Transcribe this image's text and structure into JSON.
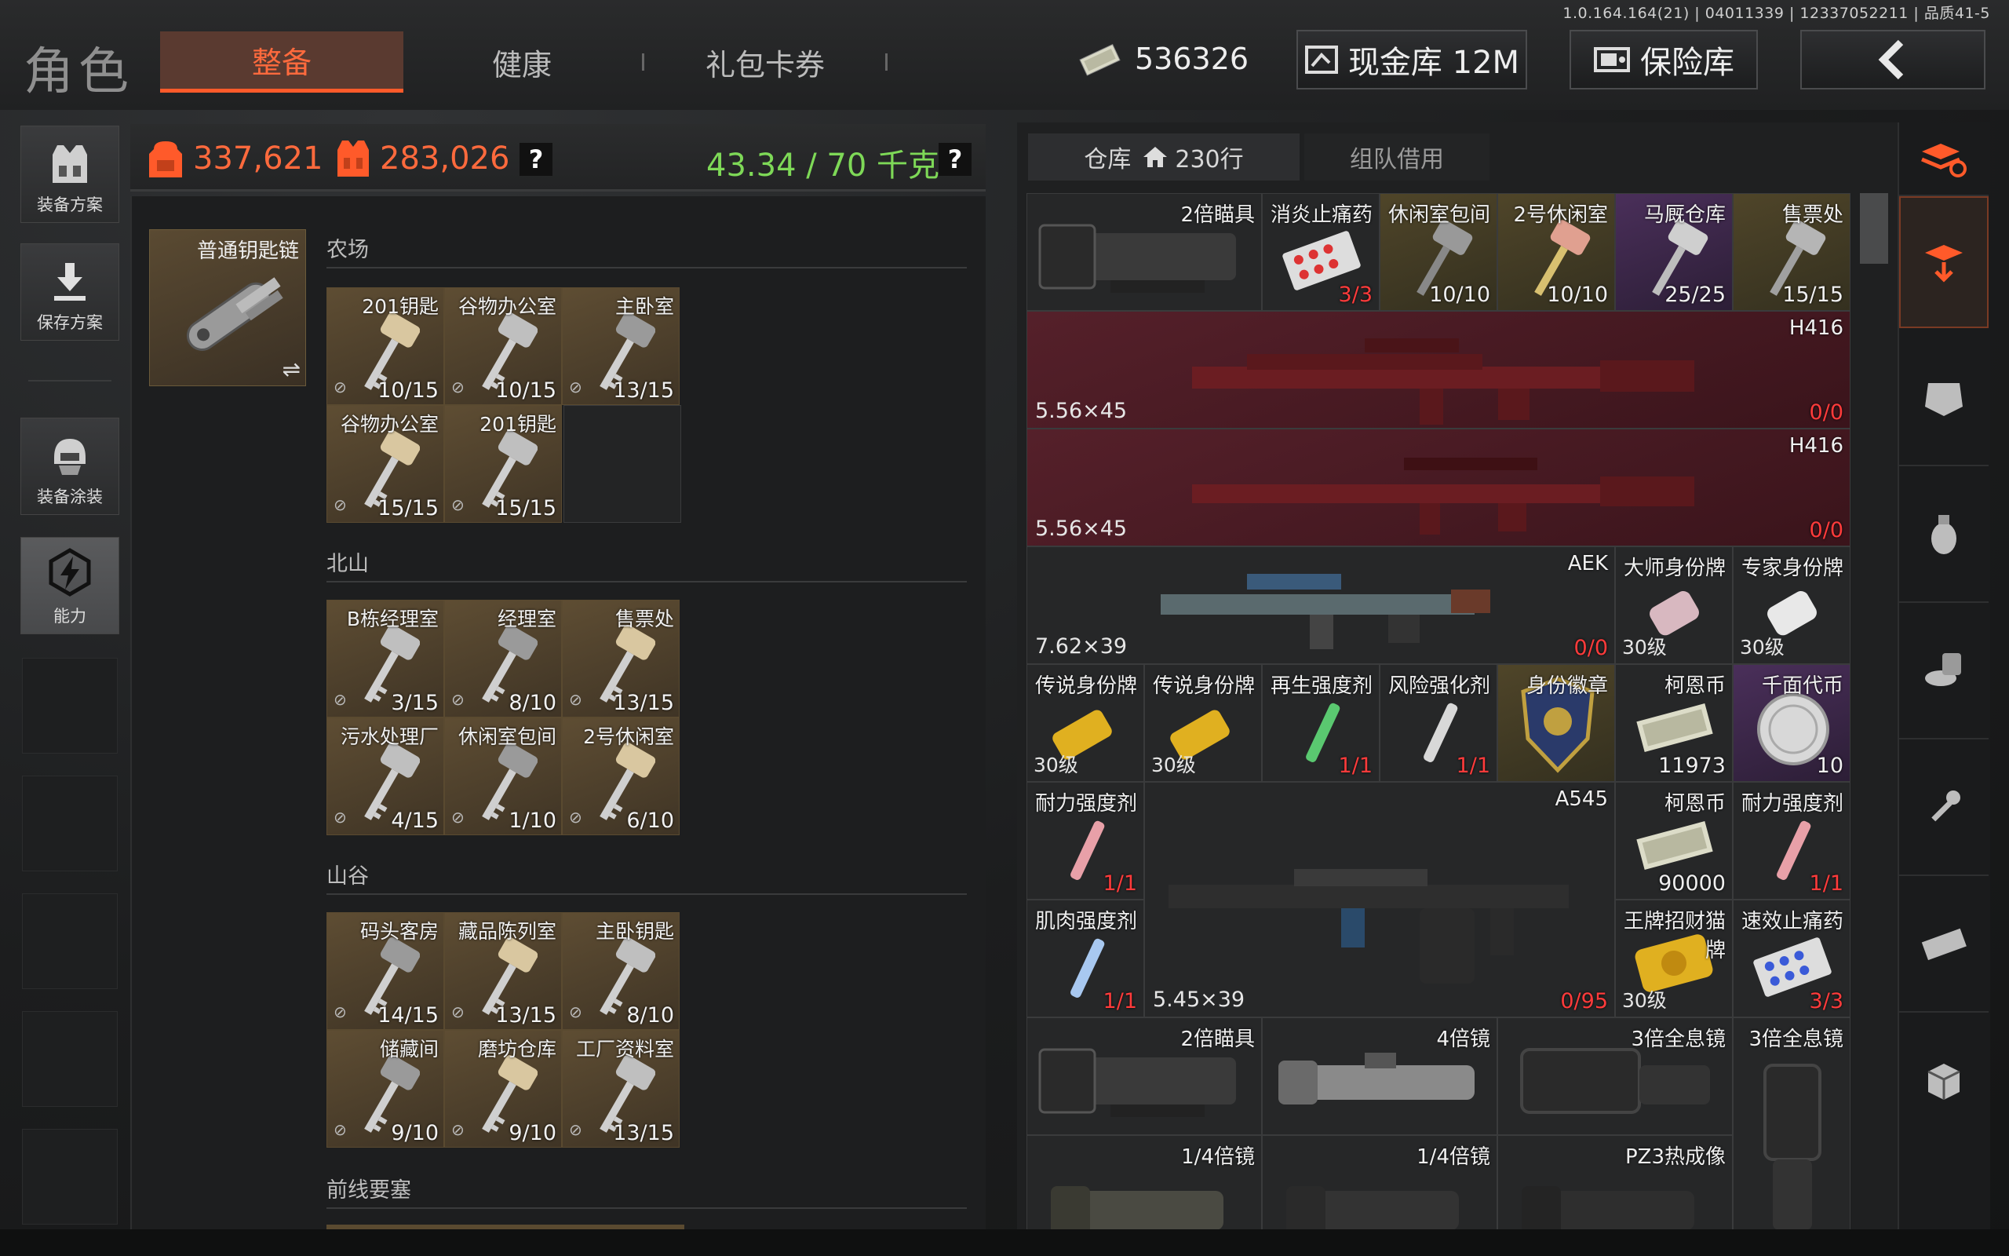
{
  "version": "1.0.164.164(21) | 04011339 | 12337052211 | 品质41-5",
  "title": "角色",
  "tabs": [
    {
      "label": "整备"
    },
    {
      "label": "健康"
    },
    {
      "label": "礼包卡券"
    }
  ],
  "currency": {
    "amount": "536326"
  },
  "cash_vault": {
    "label": "现金库 12M"
  },
  "safe": {
    "label": "保险库"
  },
  "left_buttons": [
    {
      "label": "装备方案"
    },
    {
      "label": "保存方案"
    },
    {
      "label": "装备涂装"
    },
    {
      "label": "能力"
    }
  ],
  "stats": {
    "value1": "337,621",
    "value2": "283,026",
    "weight": "43.34 / 70 千克",
    "help": "?"
  },
  "keychain": {
    "label": "普通钥匙链",
    "swap": "⇌"
  },
  "sections": [
    {
      "name": "农场",
      "keys": [
        {
          "name": "201钥匙",
          "count": "10/15"
        },
        {
          "name": "谷物办公室",
          "count": "10/15"
        },
        {
          "name": "主卧室",
          "count": "13/15"
        },
        {
          "name": "谷物办公室",
          "count": "15/15"
        },
        {
          "name": "201钥匙",
          "count": "15/15"
        }
      ]
    },
    {
      "name": "北山",
      "keys": [
        {
          "name": "B栋经理室",
          "count": "3/15"
        },
        {
          "name": "经理室",
          "count": "8/10"
        },
        {
          "name": "售票处",
          "count": "13/15"
        },
        {
          "name": "污水处理厂",
          "count": "4/15"
        },
        {
          "name": "休闲室包间",
          "count": "1/10"
        },
        {
          "name": "2号休闲室",
          "count": "6/10"
        }
      ]
    },
    {
      "name": "山谷",
      "keys": [
        {
          "name": "码头客房",
          "count": "14/15"
        },
        {
          "name": "藏品陈列室",
          "count": "13/15"
        },
        {
          "name": "主卧钥匙",
          "count": "8/10"
        },
        {
          "name": "储藏间",
          "count": "9/10"
        },
        {
          "name": "磨坊仓库",
          "count": "9/10"
        },
        {
          "name": "工厂资料室",
          "count": "13/15"
        }
      ]
    },
    {
      "name": "前线要塞",
      "keys": []
    }
  ],
  "warehouse": {
    "tab_label": "仓库",
    "rows": "230行",
    "team_tab": "组队借用"
  },
  "items": {
    "scope2x_a": {
      "name": "2倍瞄具"
    },
    "painkiller": {
      "name": "消炎止痛药",
      "count": "3/3"
    },
    "k_lounge": {
      "name": "休闲室包间",
      "count": "10/10"
    },
    "k_lounge2": {
      "name": "2号休闲室",
      "count": "10/10"
    },
    "k_stable": {
      "name": "马厩仓库",
      "count": "25/25"
    },
    "k_ticket": {
      "name": "售票处",
      "count": "15/15"
    },
    "h416a": {
      "name": "H416",
      "caliber": "5.56×45",
      "ammo": "0/0"
    },
    "h416b": {
      "name": "H416",
      "caliber": "5.56×45",
      "ammo": "0/0"
    },
    "aek": {
      "name": "AEK",
      "caliber": "7.62×39",
      "ammo": "0/0"
    },
    "tag_master": {
      "name": "大师身份牌",
      "level": "30级"
    },
    "tag_expert": {
      "name": "专家身份牌",
      "level": "30级"
    },
    "tag_legend1": {
      "name": "传说身份牌",
      "level": "30级"
    },
    "tag_legend2": {
      "name": "传说身份牌",
      "level": "30级"
    },
    "regen": {
      "name": "再生强度剂",
      "count": "1/1"
    },
    "risk": {
      "name": "风险强化剂",
      "count": "1/1"
    },
    "badge": {
      "name": "身份徽章"
    },
    "coin1": {
      "name": "柯恩币",
      "count": "11973"
    },
    "faceless": {
      "name": "千面代币",
      "count": "10"
    },
    "stamina1": {
      "name": "耐力强度剂",
      "count": "1/1"
    },
    "a545": {
      "name": "A545",
      "caliber": "5.45×39",
      "ammo": "0/95"
    },
    "coin2": {
      "name": "柯恩币",
      "count": "90000"
    },
    "stamina2": {
      "name": "耐力强度剂",
      "count": "1/1"
    },
    "muscle": {
      "name": "肌肉强度剂",
      "count": "1/1"
    },
    "cat": {
      "name": "王牌招财猫牌",
      "level": "30级"
    },
    "fastpk": {
      "name": "速效止痛药",
      "count": "3/3"
    },
    "scope2x_b": {
      "name": "2倍瞄具"
    },
    "scope4x": {
      "name": "4倍镜"
    },
    "holo3x_a": {
      "name": "3倍全息镜"
    },
    "holo3x_b": {
      "name": "3倍全息镜"
    },
    "q1": {
      "name": "1/4倍镜"
    },
    "q2": {
      "name": "1/4倍镜"
    },
    "pz3": {
      "name": "PZ3热成像"
    }
  },
  "colors": {
    "accent": "#ff5a2a",
    "weight": "#7ed957",
    "stat": "#ff6a3d",
    "danger": "#ff3b3b"
  }
}
